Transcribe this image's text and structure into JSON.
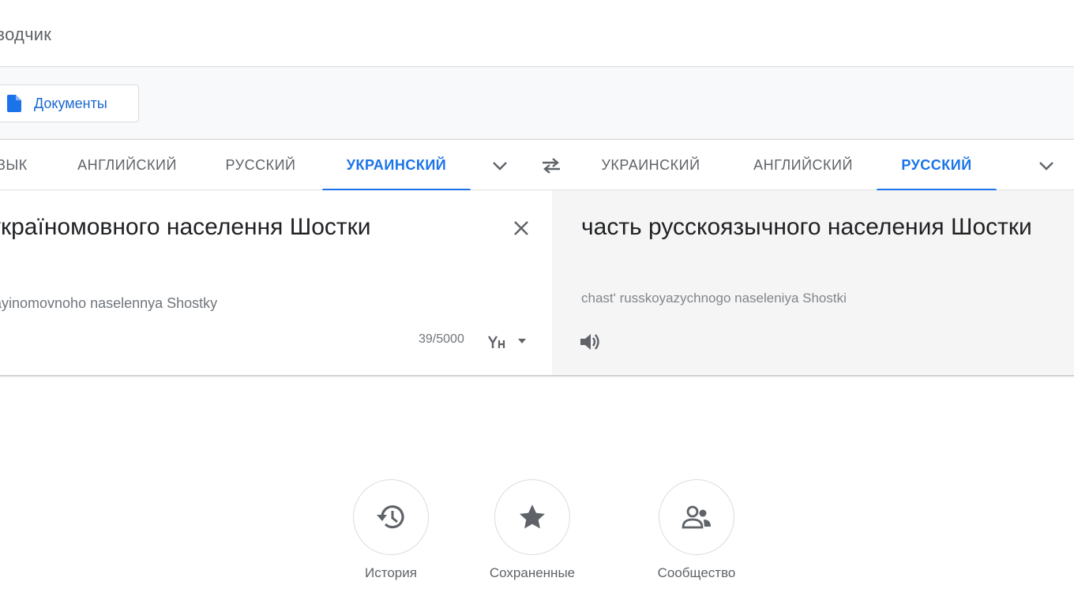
{
  "header": {
    "title": "еводчик"
  },
  "toolbar": {
    "documents_label": "Документы"
  },
  "source_langs": [
    {
      "label": "ЗЫК"
    },
    {
      "label": "АНГЛИЙСКИЙ"
    },
    {
      "label": "РУССКИЙ"
    },
    {
      "label": "УКРАИНСКИЙ",
      "active": true
    }
  ],
  "target_langs": [
    {
      "label": "УКРАИНСКИЙ"
    },
    {
      "label": "АНГЛИЙСКИЙ"
    },
    {
      "label": "РУССКИЙ",
      "active": true
    }
  ],
  "source": {
    "text": "україномовного населення Шостки",
    "transliteration": "ayinomovnoho naselennya Shostky",
    "char_count": "39/5000"
  },
  "target": {
    "text": "часть русскоязычного населения Шостки",
    "transliteration": "chast' russkoyazychnogo naseleniya Shostki"
  },
  "shortcuts": {
    "history": "История",
    "saved": "Сохраненные",
    "community": "Сообщество"
  },
  "colors": {
    "accent": "#1a73e8",
    "icon": "#5f6368"
  },
  "icons": [
    "document-icon",
    "chevron-down-icon",
    "swap-icon",
    "close-icon",
    "keyboard-icon",
    "speaker-icon",
    "history-icon",
    "star-icon",
    "community-icon"
  ]
}
